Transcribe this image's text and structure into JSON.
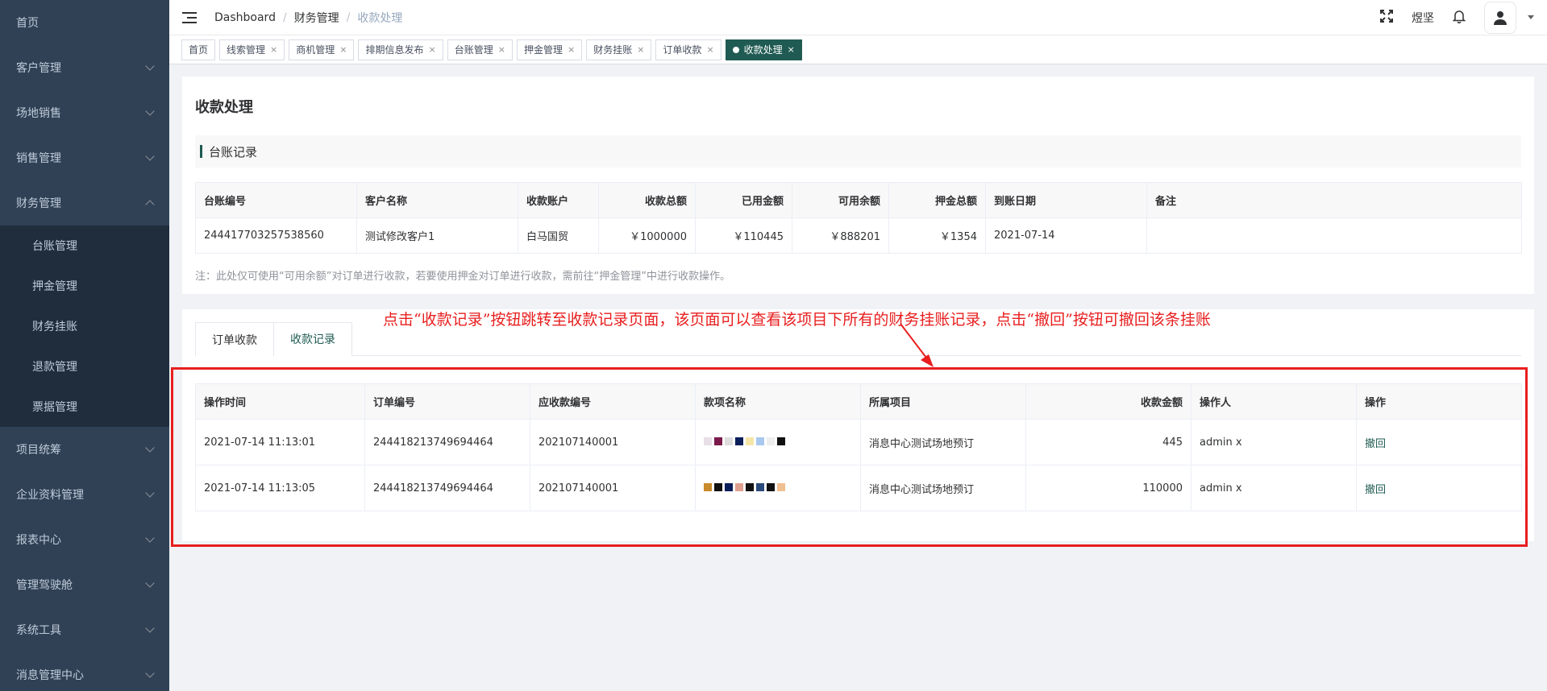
{
  "sidebar": {
    "items": [
      {
        "label": "首页",
        "has_arrow": false
      },
      {
        "label": "客户管理",
        "has_arrow": true
      },
      {
        "label": "场地销售",
        "has_arrow": true
      },
      {
        "label": "销售管理",
        "has_arrow": true
      },
      {
        "label": "财务管理",
        "has_arrow": true,
        "open": true
      },
      {
        "label": "项目统筹",
        "has_arrow": true
      },
      {
        "label": "企业资料管理",
        "has_arrow": true
      },
      {
        "label": "报表中心",
        "has_arrow": true
      },
      {
        "label": "管理驾驶舱",
        "has_arrow": true
      },
      {
        "label": "系统工具",
        "has_arrow": true
      },
      {
        "label": "消息管理中心",
        "has_arrow": true
      }
    ],
    "finance_sub": [
      "台账管理",
      "押金管理",
      "财务挂账",
      "退款管理",
      "票据管理"
    ]
  },
  "header": {
    "breadcrumb": [
      "Dashboard",
      "财务管理",
      "收款处理"
    ],
    "username": "煜坚",
    "icons": [
      "hamburger-icon",
      "fullscreen-icon",
      "bell-icon",
      "user-avatar-icon"
    ]
  },
  "tags": [
    {
      "label": "首页",
      "closable": false
    },
    {
      "label": "线索管理",
      "closable": true
    },
    {
      "label": "商机管理",
      "closable": true
    },
    {
      "label": "排期信息发布",
      "closable": true
    },
    {
      "label": "台账管理",
      "closable": true
    },
    {
      "label": "押金管理",
      "closable": true
    },
    {
      "label": "财务挂账",
      "closable": true
    },
    {
      "label": "订单收款",
      "closable": true
    },
    {
      "label": "收款处理",
      "closable": true,
      "active": true
    }
  ],
  "page": {
    "title": "收款处理",
    "section_title": "台账记录",
    "ledger": {
      "columns": [
        "台账编号",
        "客户名称",
        "收款账户",
        "收款总额",
        "已用金额",
        "可用余额",
        "押金总额",
        "到账日期",
        "备注"
      ],
      "row": [
        "244417703257538560",
        "测试修改客户1",
        "白马国贸",
        "￥1000000",
        "￥110445",
        "￥888201",
        "￥1354",
        "2021-07-14",
        ""
      ]
    },
    "note": "注：此处仅可使用“可用余额”对订单进行收款，若要使用押金对订单进行收款，需前往“押金管理”中进行收款操作。",
    "tabs": [
      "订单收款",
      "收款记录"
    ],
    "active_tab": 1,
    "records": {
      "columns": [
        "操作时间",
        "订单编号",
        "应收款编号",
        "款项名称",
        "所属项目",
        "收款金额",
        "操作人",
        "操作"
      ],
      "rows": [
        [
          "2021-07-14 11:13:01",
          "244418213749694464",
          "202107140001",
          "",
          "消息中心测试场地预订",
          "445",
          "admin x",
          "撤回"
        ],
        [
          "2021-07-14 11:13:05",
          "244418213749694464",
          "202107140001",
          "",
          "消息中心测试场地预订",
          "110000",
          "admin x",
          "撤回"
        ]
      ]
    }
  },
  "annotation": {
    "text": "点击“收款记录”按钮跳转至收款记录页面，该页面可以查看该项目下所有的财务挂账记录，点击“撤回”按钮可撤回该条挂账"
  },
  "colors": {
    "sidebar_bg": "#304156",
    "submenu_bg": "#1f2d3d",
    "accent": "#1f5b52",
    "annotation": "#e81e1e"
  }
}
